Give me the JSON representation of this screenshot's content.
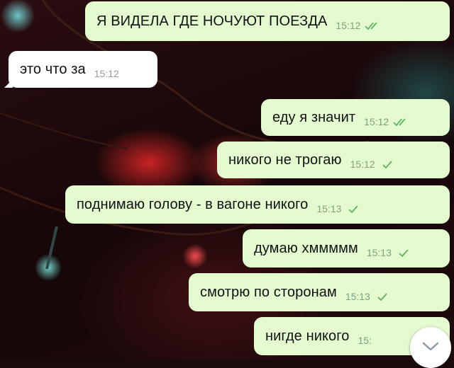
{
  "messages": [
    {
      "text": "Я ВИДЕЛА ГДЕ НОЧУЮТ ПОЕЗДА",
      "time": "15:12",
      "direction": "outgoing",
      "status": "read"
    },
    {
      "text": "это что за",
      "time": "15:12",
      "direction": "incoming"
    },
    {
      "text": "еду я значит",
      "time": "15:12",
      "direction": "outgoing",
      "status": "read"
    },
    {
      "text": "никого не трогаю",
      "time": "15:12",
      "direction": "outgoing",
      "status": "sent"
    },
    {
      "text": "поднимаю голову - в вагоне никого",
      "time": "15:13",
      "direction": "outgoing",
      "status": "sent"
    },
    {
      "text": "думаю хммммм",
      "time": "15:13",
      "direction": "outgoing",
      "status": "sent"
    },
    {
      "text": "смотрю по сторонам",
      "time": "15:13",
      "direction": "outgoing",
      "status": "sent"
    },
    {
      "text": "нигде никого",
      "time": "15:",
      "direction": "outgoing",
      "status": "sent"
    }
  ],
  "scroll_down_button": {
    "icon": "chevron-down-icon"
  },
  "colors": {
    "outgoing_bubble": "#e4fbd0",
    "incoming_bubble": "#ffffff",
    "check_mark": "#5fb35f",
    "time_outgoing": "#7fa07f"
  }
}
